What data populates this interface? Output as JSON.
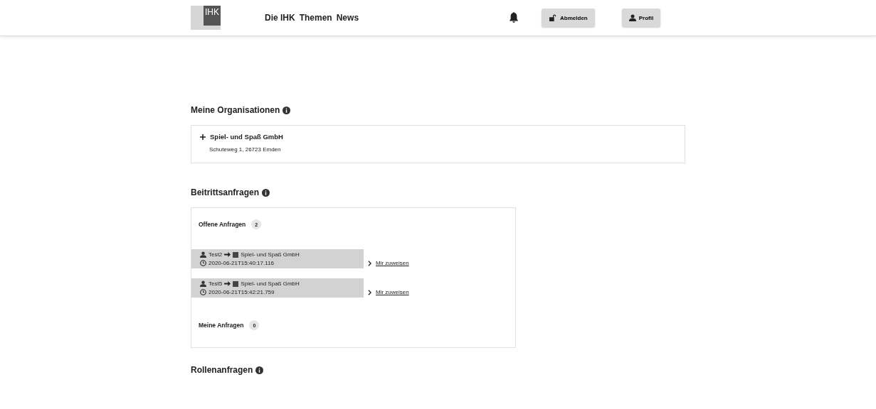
{
  "header": {
    "logo": "IHK",
    "nav": [
      "Die IHK",
      "Themen",
      "News"
    ],
    "buttons": [
      {
        "kind": "logout",
        "label": "Abmelden"
      },
      {
        "kind": "profile",
        "label": "Profil"
      }
    ]
  },
  "organisations": {
    "title": "Meine Organisationen",
    "items": [
      {
        "name": "Spiel- und Spaß GmbH",
        "address": "Schuteweg 1, 26723 Emden"
      }
    ]
  },
  "join_requests": {
    "title": "Beitrittsanfragen",
    "open": {
      "label": "Offene Anfragen",
      "count": "2",
      "items": [
        {
          "user": "Test2",
          "org": "Spiel- und Spaß GmbH",
          "time": "2020-06-21T15:40:17.116",
          "action": "Mir zuweisen"
        },
        {
          "user": "Test5",
          "org": "Spiel- und Spaß GmbH",
          "time": "2020-06-21T15:42:21.759",
          "action": "Mir zuweisen"
        }
      ]
    },
    "mine": {
      "label": "Meine Anfragen",
      "count": "0"
    }
  },
  "role_requests": {
    "title": "Rollenanfragen"
  }
}
